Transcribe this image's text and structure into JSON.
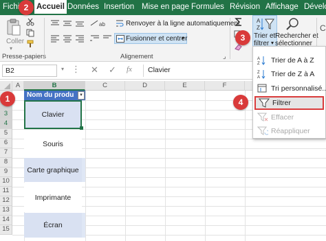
{
  "menu": {
    "tabs": [
      "Fichi",
      "Accueil",
      "Données",
      "Insertion",
      "Mise en page",
      "Formules",
      "Révision",
      "Affichage",
      "Dévelo"
    ],
    "active_tab": "Accueil"
  },
  "ribbon": {
    "paste_label": "Coller",
    "clipboard_group": "Presse-papiers",
    "wrap_text": "Renvoyer à la ligne automatiquement",
    "merge_center": "Fusionner et centrer",
    "alignment_group": "Alignement",
    "sort_filter_line1": "Trier et",
    "sort_filter_line2": "filtrer",
    "find_select_line1": "Rechercher et",
    "find_select_line2": "sélectionner"
  },
  "formula_bar": {
    "name_box": "B2",
    "content": "Clavier"
  },
  "columns": [
    "A",
    "B",
    "C",
    "D",
    "E",
    "F"
  ],
  "rows": [
    "1",
    "2",
    "3",
    "4",
    "5",
    "6",
    "7",
    "8",
    "9",
    "10",
    "11",
    "12",
    "13",
    "14",
    "15"
  ],
  "table": {
    "header": "Nom du produ",
    "items": [
      "Clavier",
      "Souris",
      "Carte graphique",
      "Imprimante",
      "Écran"
    ]
  },
  "dropdown": {
    "items": [
      {
        "label": "Trier de A à Z",
        "enabled": true
      },
      {
        "label": "Trier de Z à A",
        "enabled": true
      },
      {
        "label": "Tri personnalisé...",
        "enabled": true
      },
      {
        "label": "Filtrer",
        "enabled": true,
        "highlighted": true
      },
      {
        "label": "Effacer",
        "enabled": false
      },
      {
        "label": "Réappliquer",
        "enabled": false
      }
    ]
  },
  "steps": [
    "1",
    "2",
    "3",
    "4"
  ],
  "colors": {
    "excel_green": "#217346",
    "table_header": "#4472c4",
    "table_band": "#d9e1f2",
    "callout": "#d93a3a"
  }
}
